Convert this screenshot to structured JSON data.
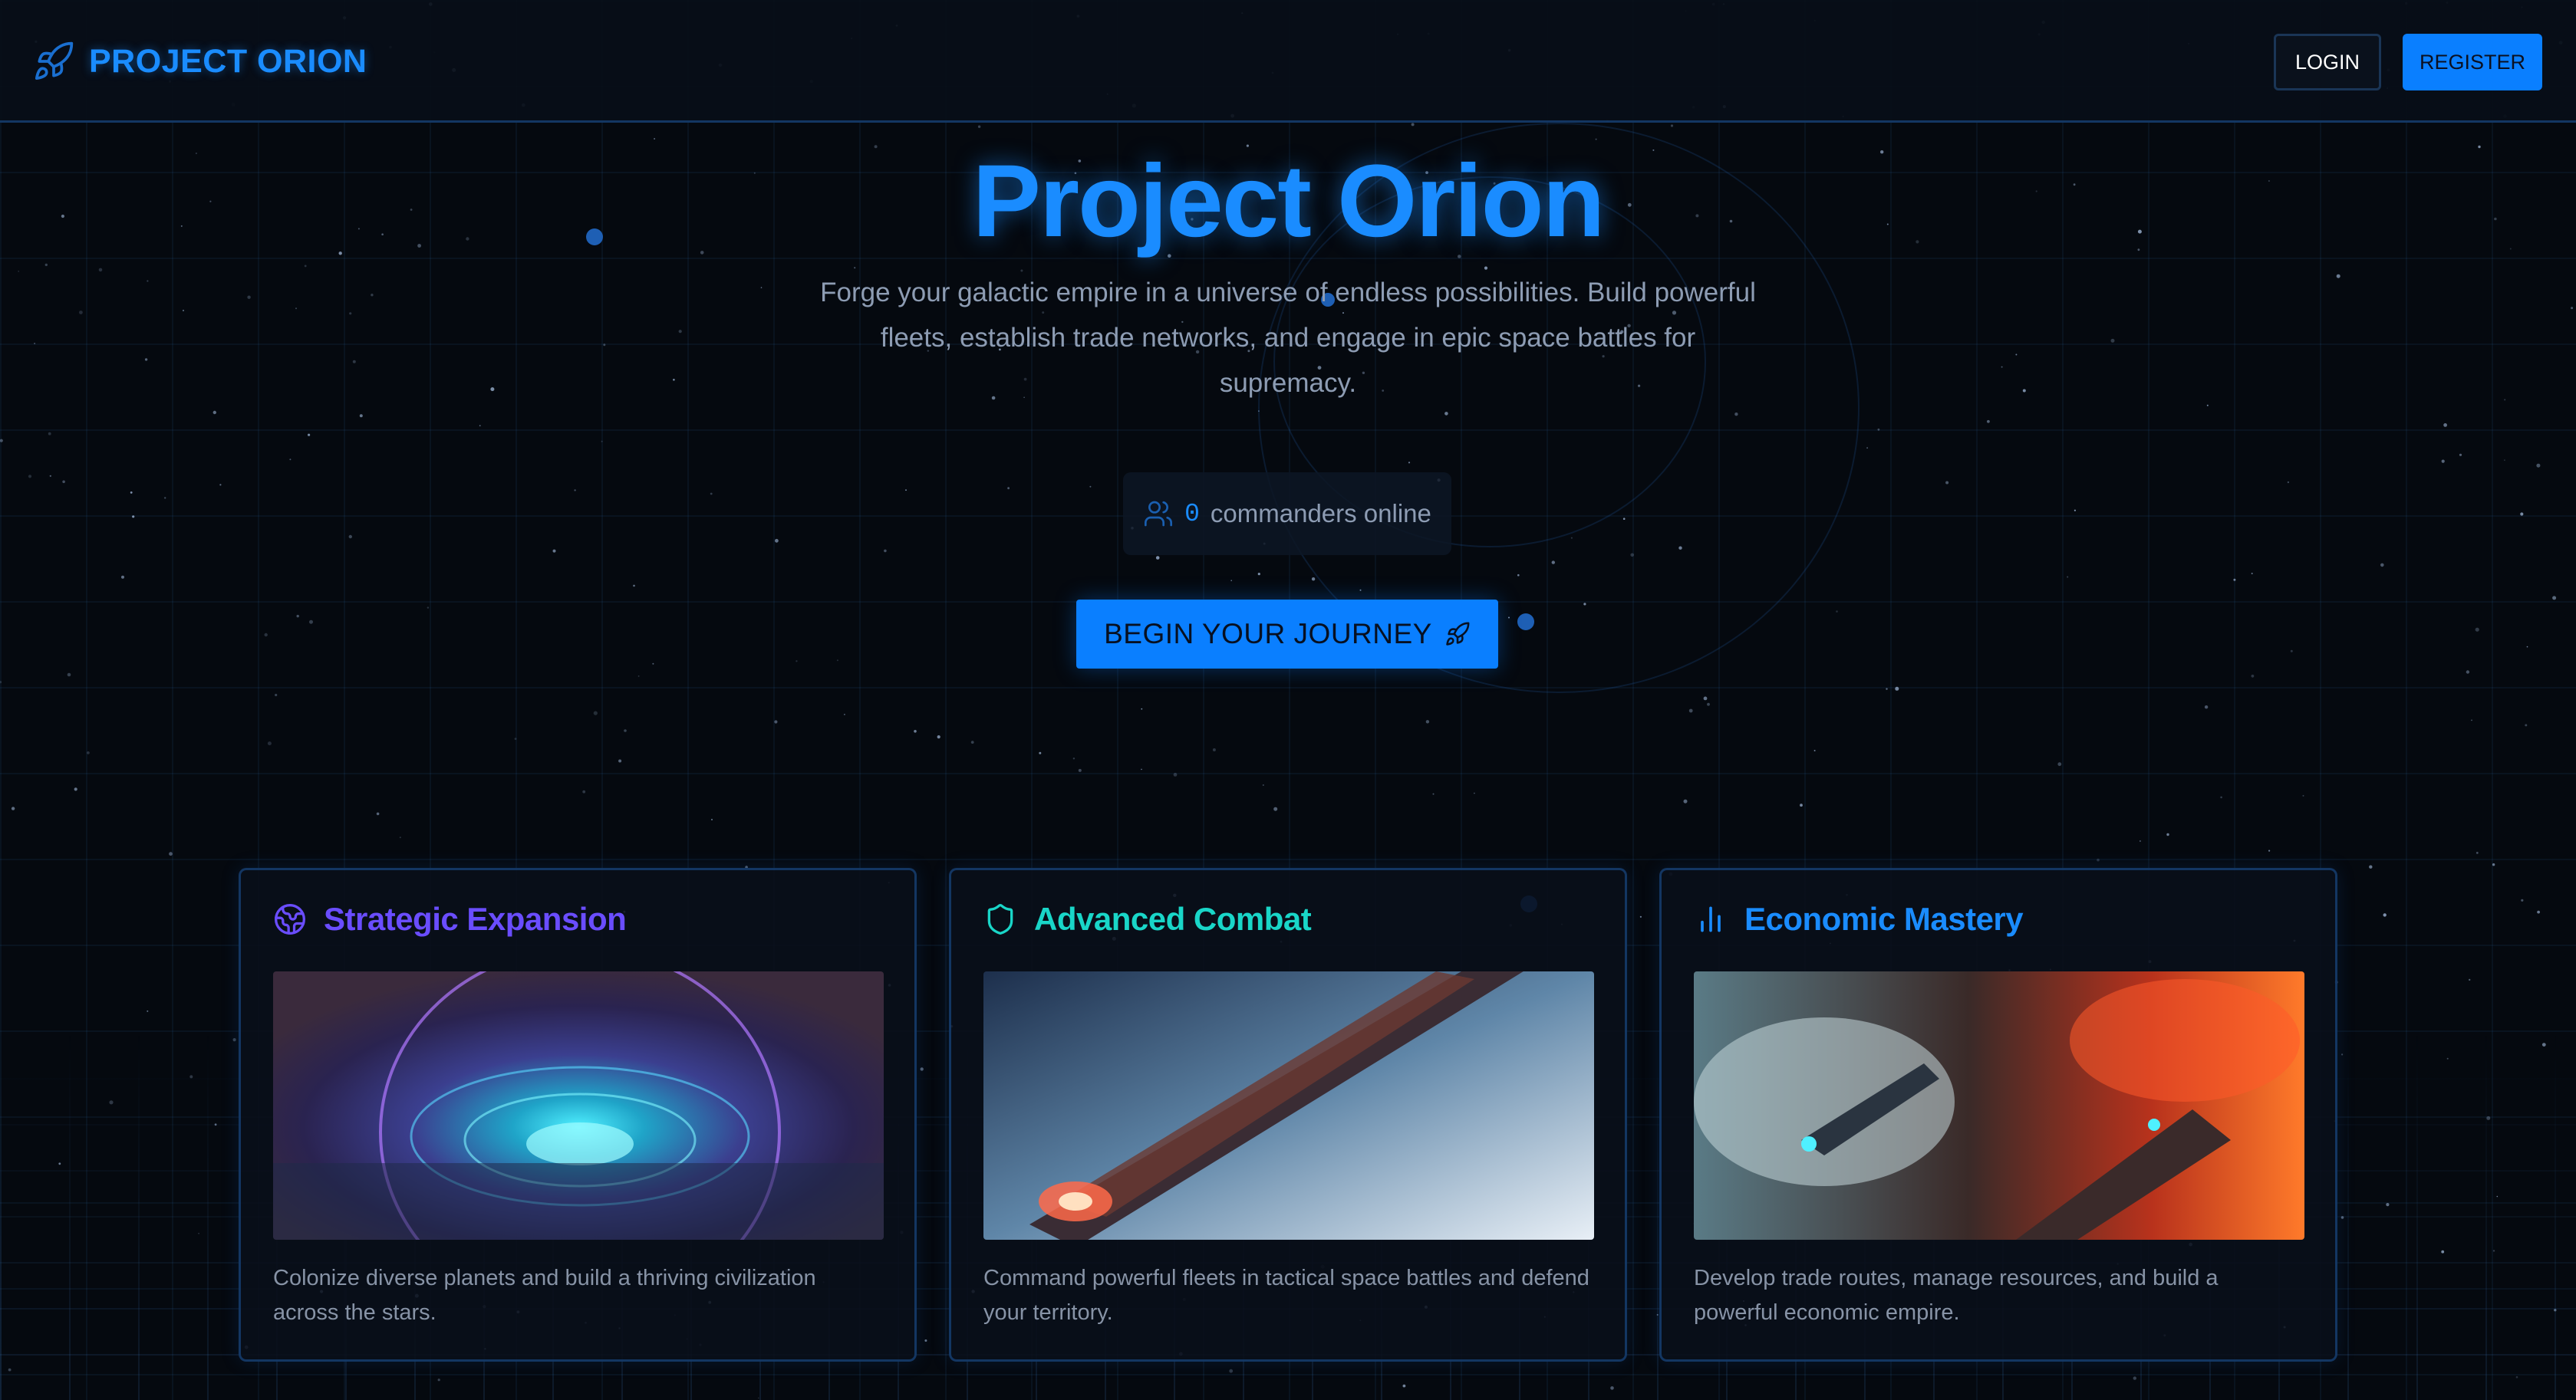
{
  "header": {
    "brand_name": "PROJECT ORION",
    "brand_icon": "rocket-icon",
    "login_label": "LOGIN",
    "register_label": "REGISTER"
  },
  "hero": {
    "title": "Project Orion",
    "description": "Forge your galactic empire in a universe of endless possibilities. Build powerful fleets, establish trade networks, and engage in epic space battles for supremacy.",
    "online_count": "0",
    "online_label": "commanders online",
    "online_icon": "users-icon",
    "cta_label": "BEGIN YOUR JOURNEY",
    "cta_icon": "rocket-icon"
  },
  "features": [
    {
      "title": "Strategic Expansion",
      "icon": "globe-icon",
      "color": "#6a4dff",
      "image": "domed-city-illustration",
      "description": "Colonize diverse planets and build a thriving civilization across the stars."
    },
    {
      "title": "Advanced Combat",
      "icon": "shield-icon",
      "color": "#19d6c8",
      "image": "battleship-illustration",
      "description": "Command powerful fleets in tactical space battles and defend your territory."
    },
    {
      "title": "Economic Mastery",
      "icon": "bar-chart-icon",
      "color": "#1a8cff",
      "image": "trade-ships-illustration",
      "description": "Develop trade routes, manage resources, and build a powerful economic empire."
    }
  ],
  "colors": {
    "accent": "#0a7fff",
    "background": "#05090f",
    "text_muted": "#8d9cb3"
  }
}
